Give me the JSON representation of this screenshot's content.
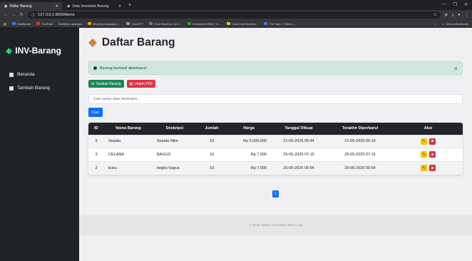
{
  "browser": {
    "tabs": [
      {
        "label": "Daftar Barang",
        "active": true
      },
      {
        "label": "Data Inventaris Barang",
        "active": false
      }
    ],
    "new_tab": "+",
    "url": "127.0.0.1:8000/items",
    "bookmarks": [
      "Dashboard",
      "YouTube",
      "Booking Lapangan",
      "Booking Lapangan |...",
      "ChatGPT",
      "Chat Blackbox: AI C...",
      "Worksheet 5BMS Yo...",
      "CodeCraft Montrep...",
      "The Stoic 3 | Best s..."
    ],
    "bookmarks_right": "Semua Bookmark"
  },
  "sidebar": {
    "brand": "INV-Barang",
    "items": [
      {
        "label": "Beranda"
      },
      {
        "label": "Tambah Barang"
      }
    ]
  },
  "page": {
    "title": "Daftar Barang",
    "alert": "Barang berhasil diperbarui!",
    "alert_close": "×",
    "add_button": "Tambah Barang",
    "pdf_button": "Unduh PDF",
    "search_placeholder": "Cari nama atau deskripsi...",
    "search_button": "Cari"
  },
  "table": {
    "headers": [
      "ID",
      "Nama Barang",
      "Deskripsi",
      "Jumlah",
      "Harga",
      "Tanggal Dibuat",
      "Terakhir Diperbarui",
      "Aksi"
    ],
    "rows": [
      {
        "id": "9",
        "name": "Sepatu",
        "desc": "Sepatu Nike",
        "qty": "10",
        "price": "Rp 5.000.000",
        "created": "21-06-2025 05:44",
        "updated": "21-06-2025 06:14"
      },
      {
        "id": "3",
        "name": "CELANA",
        "desc": "BAGUS",
        "qty": "10",
        "price": "Rp 7.000",
        "created": "25-05-2025 07:15",
        "updated": "25-05-2025 07:15"
      },
      {
        "id": "2",
        "name": "buku",
        "desc": "begitu bagus",
        "qty": "19",
        "price": "Rp 7.000",
        "created": "25-05-2025 05:54",
        "updated": "25-05-2025 05:54"
      }
    ]
  },
  "pagination": {
    "current": "1"
  },
  "footer": {
    "text": "© 2025 Sistem Inventaris Bimo Adji"
  },
  "colors": {
    "primary": "#0d6efd",
    "success": "#198754",
    "danger": "#dc3545",
    "warning": "#ffc107",
    "dark": "#212529"
  }
}
